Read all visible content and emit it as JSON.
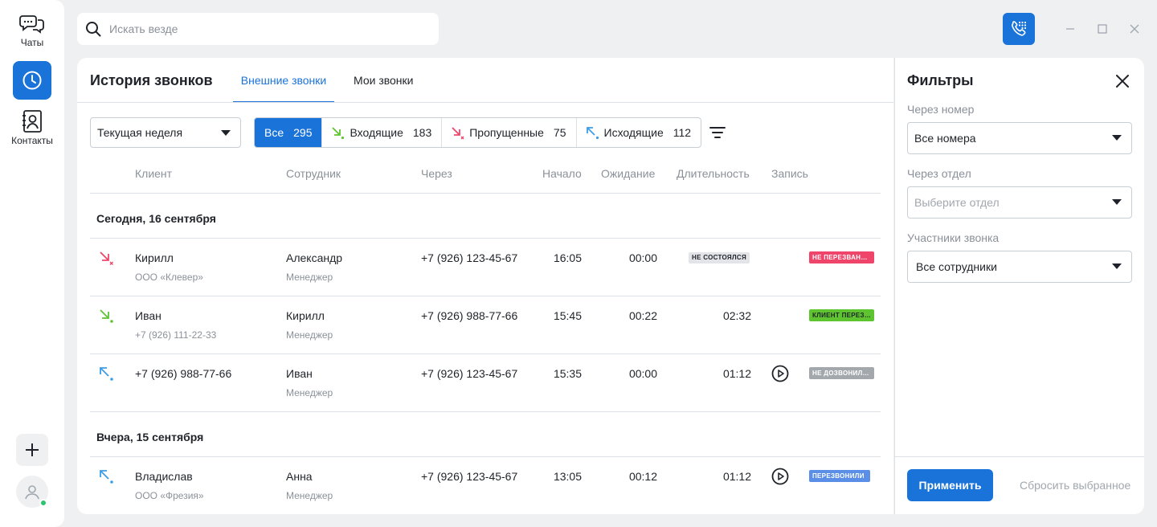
{
  "nav": {
    "chats_label": "Чаты",
    "contacts_label": "Контакты"
  },
  "search": {
    "placeholder": "Искать везде"
  },
  "main": {
    "title": "История звонков",
    "tabs": [
      {
        "label": "Внешние звонки",
        "active": true
      },
      {
        "label": "Мои звонки",
        "active": false
      }
    ],
    "period": "Текущая неделя",
    "segments": [
      {
        "label": "Все",
        "count": "295",
        "icon": "none",
        "active": true
      },
      {
        "label": "Входящие",
        "count": "183",
        "icon": "incoming-call-icon",
        "active": false
      },
      {
        "label": "Пропущенные",
        "count": "75",
        "icon": "missed-call-icon",
        "active": false
      },
      {
        "label": "Исходящие",
        "count": "112",
        "icon": "outgoing-call-icon",
        "active": false
      }
    ],
    "columns": [
      "Клиент",
      "Сотрудник",
      "Через",
      "Начало",
      "Ожидание",
      "Длительность",
      "Запись"
    ],
    "groups": [
      {
        "title": "Сегодня, 16 сентября",
        "rows": [
          {
            "dir": "missed",
            "client": "Кирилл",
            "client_sub": "ООО «Клевер»",
            "employee": "Александр",
            "employee_sub": "Менеджер",
            "via": "+7 (926) 123-45-67",
            "start": "16:05",
            "wait": "00:00",
            "duration": "",
            "duration_badge": "НЕ СОСТОЯЛСЯ",
            "record": false,
            "status": "НЕ ПЕРЕЗВАНИВАЛИ",
            "status_color": "#f0456b"
          },
          {
            "dir": "incoming",
            "client": "Иван",
            "client_sub": "+7 (926) 111-22-33",
            "employee": "Кирилл",
            "employee_sub": "Менеджер",
            "via": "+7 (926) 988-77-66",
            "start": "15:45",
            "wait": "00:22",
            "duration": "02:32",
            "duration_badge": "",
            "record": false,
            "status": "КЛИЕНТ ПЕРЕЗВОНИЛ",
            "status_color": "#5ec531"
          },
          {
            "dir": "outgoing",
            "client": "+7 (926) 988-77-66",
            "client_sub": "",
            "employee": "Иван",
            "employee_sub": "Менеджер",
            "via": "+7 (926) 123-45-67",
            "start": "15:35",
            "wait": "00:00",
            "duration": "01:12",
            "duration_badge": "",
            "record": true,
            "status": "НЕ ДОЗВОНИЛИСЬ",
            "status_color": "#a3a8ad"
          }
        ]
      },
      {
        "title": "Вчера, 15 сентября",
        "rows": [
          {
            "dir": "outgoing",
            "client": "Владислав",
            "client_sub": "ООО «Фрезия»",
            "employee": "Анна",
            "employee_sub": "Менеджер",
            "via": "+7 (926) 123-45-67",
            "start": "13:05",
            "wait": "00:12",
            "duration": "01:12",
            "duration_badge": "",
            "record": true,
            "status": "ПЕРЕЗВОНИЛИ",
            "status_color": "#5b8ee6"
          }
        ]
      }
    ]
  },
  "filters": {
    "title": "Фильтры",
    "number_label": "Через номер",
    "number_value": "Все номера",
    "dept_label": "Через отдел",
    "dept_placeholder": "Выберите отдел",
    "participants_label": "Участники звонка",
    "participants_value": "Все сотрудники",
    "apply_label": "Применить",
    "reset_label": "Сбросить выбранное"
  },
  "colors": {
    "accent": "#1a73d9",
    "incoming": "#5ec531",
    "missed": "#f0456b",
    "outgoing": "#3b9de8"
  }
}
